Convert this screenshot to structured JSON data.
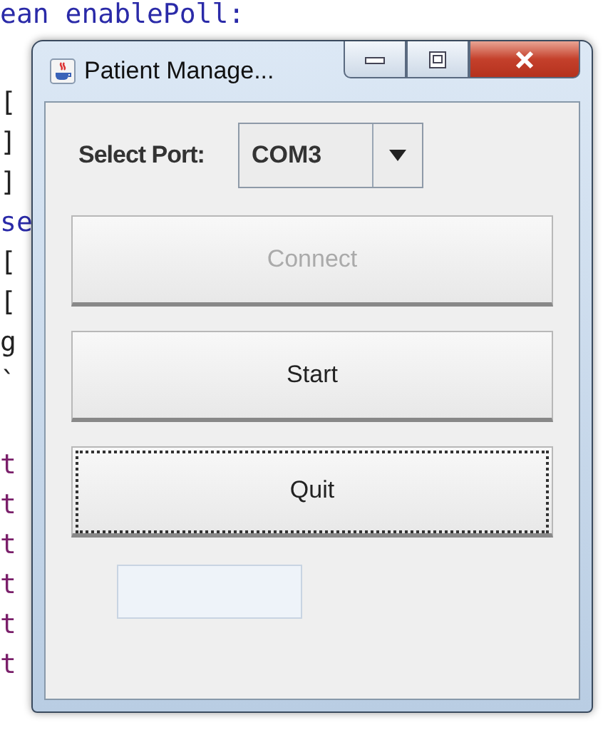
{
  "background_code": {
    "lines": [
      {
        "text": "ean enablePoll:",
        "kind": "keyword"
      },
      {
        "text": "[",
        "kind": "plain"
      },
      {
        "text": "]",
        "kind": "plain"
      },
      {
        "text": "]",
        "kind": "plain"
      },
      {
        "text": "se",
        "kind": "keyword"
      },
      {
        "text": "[",
        "kind": "plain"
      },
      {
        "text": "[",
        "kind": "plain"
      },
      {
        "text": "g",
        "kind": "plain"
      },
      {
        "text": "`",
        "kind": "plain"
      },
      {
        "text": "t",
        "kind": "field"
      },
      {
        "text": "t",
        "kind": "field"
      },
      {
        "text": "t",
        "kind": "field"
      },
      {
        "text": "t",
        "kind": "field"
      },
      {
        "text": "t",
        "kind": "field"
      },
      {
        "text": "t",
        "kind": "field"
      }
    ]
  },
  "window": {
    "title": "Patient Manage..."
  },
  "port": {
    "label": "Select Port:",
    "value": "COM3"
  },
  "buttons": [
    {
      "label": "Connect",
      "disabled": true,
      "focused": false
    },
    {
      "label": "Start",
      "disabled": false,
      "focused": false
    },
    {
      "label": "Quit",
      "disabled": false,
      "focused": true
    }
  ],
  "status_field": {
    "disabled": true
  }
}
